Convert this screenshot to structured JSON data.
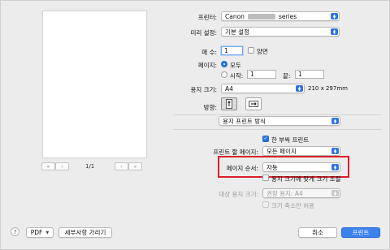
{
  "printer": {
    "label": "프린터:",
    "value_prefix": "Canon",
    "value_suffix": "series"
  },
  "presets": {
    "label": "미리 설정:",
    "value": "기본 설정"
  },
  "copies": {
    "label": "매 수:",
    "value": "1",
    "duplex_label": "양면",
    "duplex_checked": false
  },
  "pages": {
    "label": "페이지:",
    "all_label": "모두",
    "from_label": "시작:",
    "from_value": "1",
    "to_label": "끝:",
    "to_value": "1"
  },
  "paper_size": {
    "label": "용지 크기:",
    "value": "A4",
    "dimensions": "210 x 297mm"
  },
  "orientation": {
    "label": "방향:"
  },
  "section": {
    "value": "용지 프린트 방식"
  },
  "one_sided": {
    "label": "한 부씩 프린트",
    "checked": true
  },
  "pages_to_print": {
    "label": "프린트 할 페이지:",
    "value": "모든 페이지"
  },
  "page_order": {
    "label": "페이지 순서:",
    "value": "자동"
  },
  "scale_to_fit": {
    "label": "용지 크기에 맞게 크기 조절",
    "checked": false
  },
  "dest_paper": {
    "label": "대상 용지 크기:",
    "value": "권장 용지: A4"
  },
  "scale_down_only": {
    "label": "크기 축소만 허용",
    "checked": false
  },
  "preview": {
    "page_indicator": "1/1"
  },
  "footer": {
    "help": "?",
    "pdf": "PDF",
    "hide_details": "세부사항 가리기",
    "cancel": "취소",
    "print": "프린트"
  },
  "colors": {
    "accent": "#2e73e6",
    "highlight": "#d9202a"
  }
}
